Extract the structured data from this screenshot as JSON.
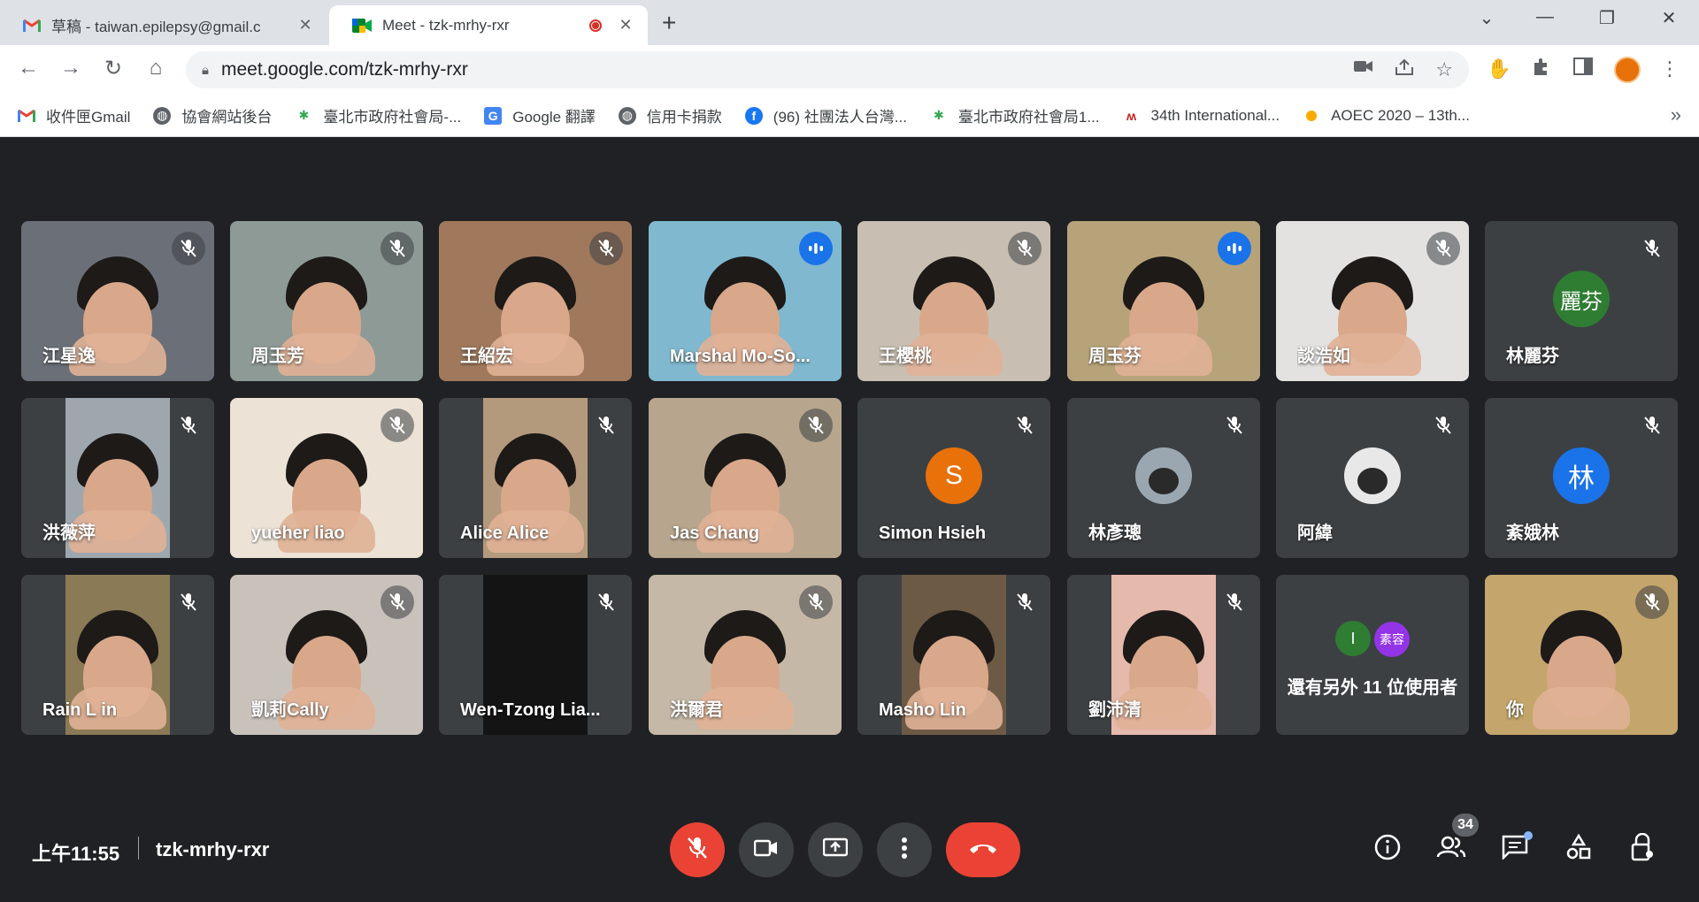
{
  "browser": {
    "tabs": [
      {
        "title": "草稿 - taiwan.epilepsy@gmail.c",
        "icon": "gmail-icon"
      },
      {
        "title": "Meet - tzk-mrhy-rxr",
        "icon": "meet-icon",
        "recording": true
      }
    ],
    "new_tab": "+",
    "url": "meet.google.com/tzk-mrhy-rxr",
    "bookmarks": [
      {
        "label": "收件匣Gmail",
        "icon": "gmail-icon"
      },
      {
        "label": "協會網站後台",
        "icon": "globe-icon"
      },
      {
        "label": "臺北市政府社會局-...",
        "icon": "taipei-icon"
      },
      {
        "label": "Google 翻譯",
        "icon": "translate-icon"
      },
      {
        "label": "信用卡捐款",
        "icon": "globe-icon"
      },
      {
        "label": "(96) 社團法人台灣...",
        "icon": "facebook-icon"
      },
      {
        "label": "臺北市政府社會局1...",
        "icon": "taipei-icon"
      },
      {
        "label": "34th International...",
        "icon": "congress-icon"
      },
      {
        "label": "AOEC 2020 – 13th...",
        "icon": "aoec-icon"
      }
    ],
    "bookmarks_more": "»"
  },
  "participants": [
    {
      "name": "江星逸",
      "mic": "muted",
      "type": "video",
      "bg": "#6b6f78"
    },
    {
      "name": "周玉芳",
      "mic": "muted",
      "type": "video",
      "bg": "#8d9a96"
    },
    {
      "name": "王紹宏",
      "mic": "muted",
      "type": "video",
      "bg": "#a0795c"
    },
    {
      "name": "Marshal Mo-So...",
      "mic": "speaking",
      "type": "video",
      "bg": "#7fb8cf"
    },
    {
      "name": "王櫻桃",
      "mic": "muted",
      "type": "video",
      "bg": "#c8bfb2"
    },
    {
      "name": "周玉芬",
      "mic": "speaking",
      "type": "video",
      "bg": "#b7a37a",
      "active": true
    },
    {
      "name": "談浩如",
      "mic": "muted",
      "type": "video",
      "bg": "#e4e2e0"
    },
    {
      "name": "林麗芬",
      "mic": "muted",
      "type": "avatar",
      "initial": "麗芬",
      "color": "#2e7d32"
    },
    {
      "name": "洪薇萍",
      "mic": "muted",
      "type": "video",
      "bg": "#9ea7ae",
      "narrow": true
    },
    {
      "name": "yueher liao",
      "mic": "muted",
      "type": "video",
      "bg": "#ece3d6"
    },
    {
      "name": "Alice Alice",
      "mic": "muted",
      "type": "video",
      "bg": "#b49a7c",
      "narrow": true
    },
    {
      "name": "Jas Chang",
      "mic": "muted",
      "type": "video",
      "bg": "#b7a68d"
    },
    {
      "name": "Simon Hsieh",
      "mic": "muted",
      "type": "avatar",
      "initial": "S",
      "color": "#e8710a"
    },
    {
      "name": "林彥璁",
      "mic": "muted",
      "type": "photo-avatar",
      "color": "#9aa7b0"
    },
    {
      "name": "阿緯",
      "mic": "muted",
      "type": "photo-avatar",
      "color": "#e8e8e8"
    },
    {
      "name": "紊娥林",
      "mic": "muted",
      "type": "avatar",
      "initial": "林",
      "color": "#1a73e8"
    },
    {
      "name": "Rain L in",
      "mic": "muted",
      "type": "video",
      "bg": "#8a7a55",
      "narrow": true
    },
    {
      "name": "凱莉Cally",
      "mic": "muted",
      "type": "video",
      "bg": "#c9c2bb"
    },
    {
      "name": "Wen-Tzong Lia...",
      "mic": "muted",
      "type": "dark",
      "bg": "#141414",
      "narrow": true
    },
    {
      "name": "洪爾君",
      "mic": "muted",
      "type": "video",
      "bg": "#c5b8a6"
    },
    {
      "name": "Masho Lin",
      "mic": "muted",
      "type": "video",
      "bg": "#6d5a45",
      "narrow": true
    },
    {
      "name": "劉沛清",
      "mic": "muted",
      "type": "video",
      "bg": "#e6b9ad",
      "narrow": true
    },
    {
      "name": "還有另外 11 位使用者",
      "type": "more",
      "mini": [
        {
          "t": "I",
          "c": "#2e7d32"
        },
        {
          "t": "素容",
          "c": "#9334e6"
        }
      ]
    },
    {
      "name": "你",
      "mic": "muted",
      "type": "video",
      "bg": "#c4a56b",
      "self": true
    }
  ],
  "footer": {
    "time": "上午11:55",
    "meeting_code": "tzk-mrhy-rxr",
    "people_count": "34"
  }
}
